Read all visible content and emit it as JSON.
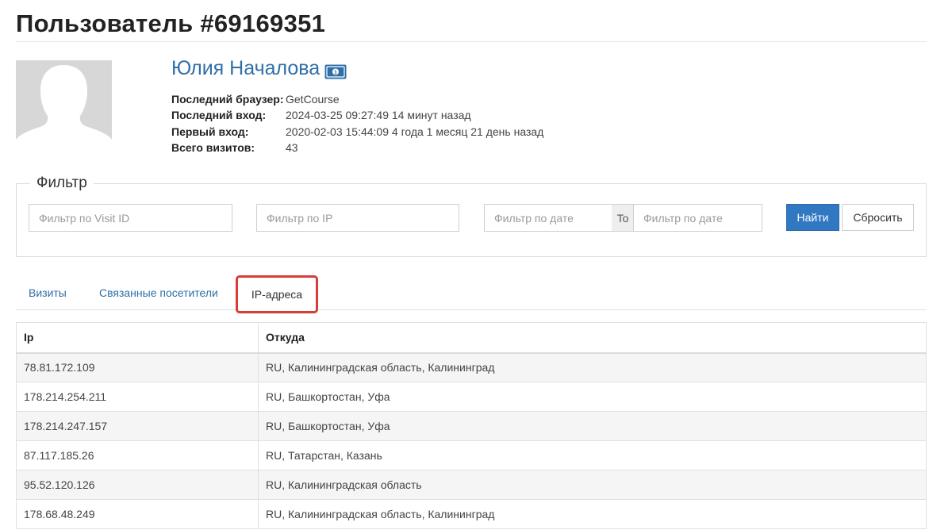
{
  "page": {
    "title": "Пользователь #69169351"
  },
  "user": {
    "name": "Юлия Началова",
    "badge_icon": "money-icon",
    "info": [
      {
        "label": "Последний браузер:",
        "value": "GetCourse"
      },
      {
        "label": "Последний вход:",
        "value": "2024-03-25 09:27:49 14 минут назад"
      },
      {
        "label": "Первый вход:",
        "value": "2020-02-03 15:44:09 4 года 1 месяц 21 день назад"
      },
      {
        "label": "Всего визитов:",
        "value": "43"
      }
    ]
  },
  "filter": {
    "legend": "Фильтр",
    "visit_id_placeholder": "Фильтр по Visit ID",
    "ip_placeholder": "Фильтр по IP",
    "date_from_placeholder": "Фильтр по дате",
    "to_label": "To",
    "date_to_placeholder": "Фильтр по дате",
    "find_label": "Найти",
    "reset_label": "Сбросить"
  },
  "tabs": [
    {
      "label": "Визиты"
    },
    {
      "label": "Связанные посетители"
    },
    {
      "label": "IP-адреса",
      "active": true
    }
  ],
  "table": {
    "headers": [
      "Ip",
      "Откуда"
    ],
    "rows": [
      [
        "78.81.172.109",
        "RU, Калининградская область, Калининград"
      ],
      [
        "178.214.254.211",
        "RU, Башкортостан, Уфа"
      ],
      [
        "178.214.247.157",
        "RU, Башкортостан, Уфа"
      ],
      [
        "87.117.185.26",
        "RU, Татарстан, Казань"
      ],
      [
        "95.52.120.126",
        "RU, Калининградская область"
      ],
      [
        "178.68.48.249",
        "RU, Калининградская область, Калининград"
      ]
    ]
  },
  "colors": {
    "link": "#2f6fa8",
    "primary_button": "#3178c2",
    "highlight_border": "#d63d37"
  }
}
